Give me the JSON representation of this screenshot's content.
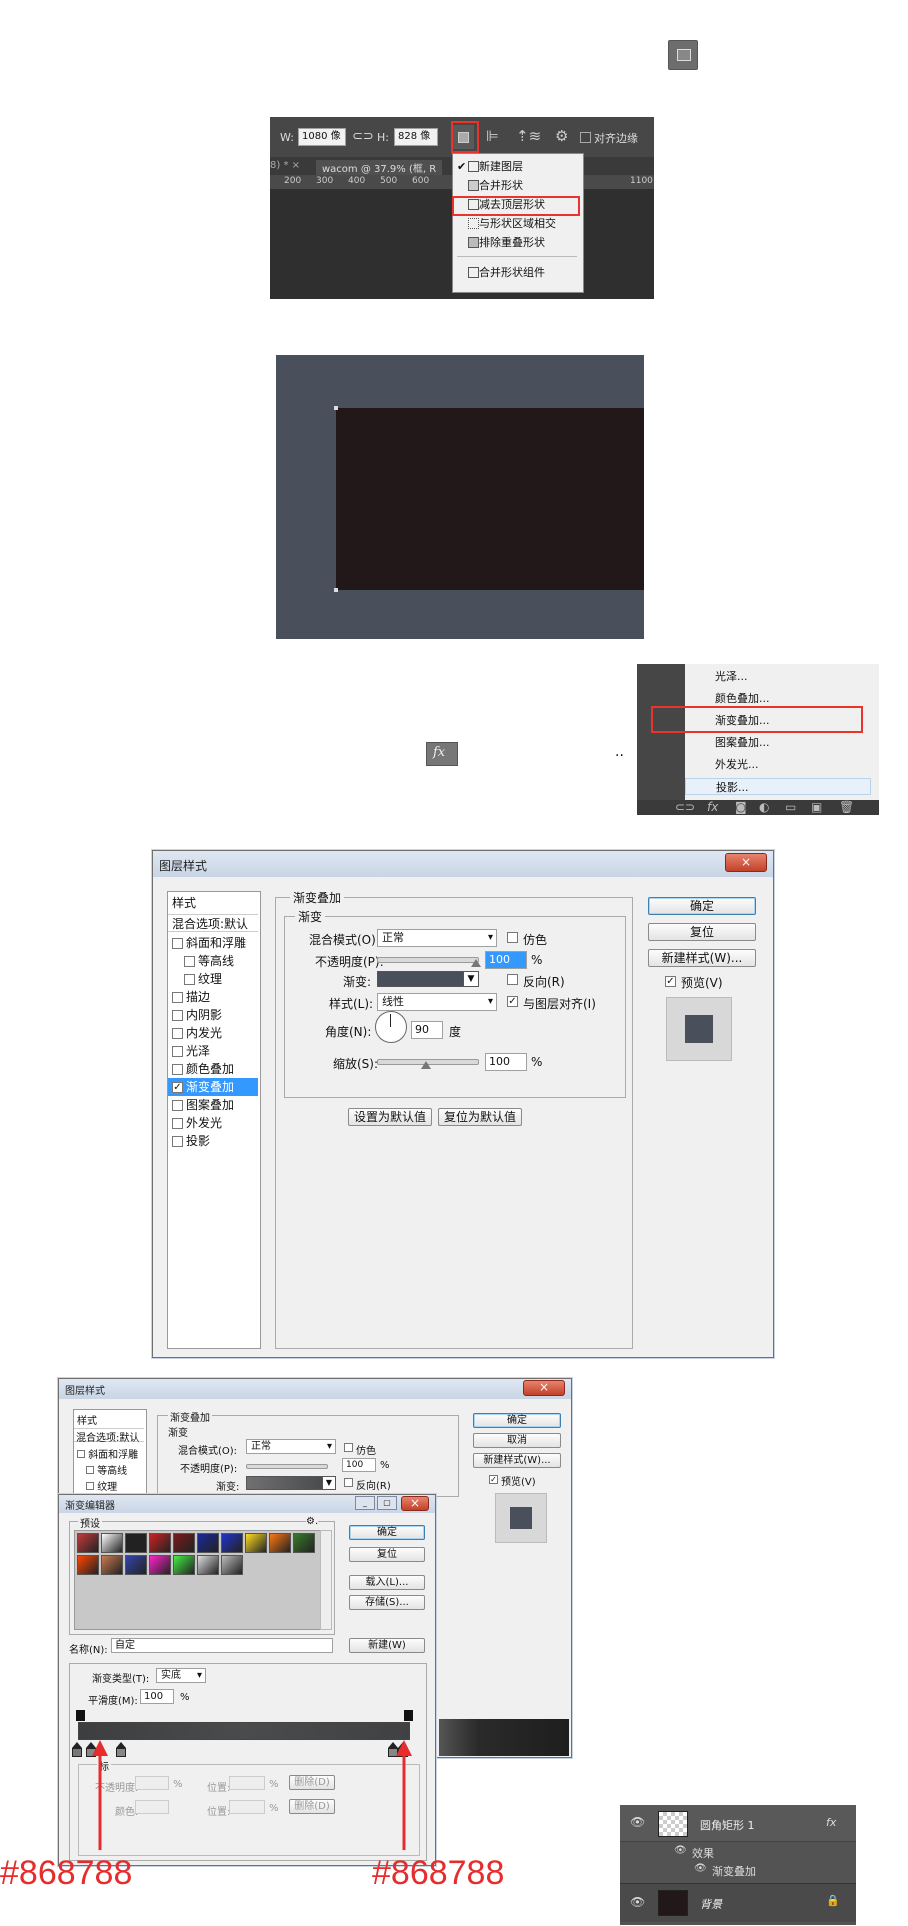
{
  "panel1": {
    "fx_icon_top": "",
    "toolbar": {
      "w_label": "W:",
      "w_value": "1080 像",
      "h_label": "H:",
      "h_value": "828 像",
      "align_edges": "对齐边缘"
    },
    "tabs": {
      "tab1": "8) * ×",
      "tab2": "wacom @ 37.9% (框, R"
    },
    "ruler": [
      "200",
      "300",
      "400",
      "500",
      "600",
      "1100"
    ],
    "menu": {
      "items": [
        "新建图层",
        "合并形状",
        "减去顶层形状",
        "与形状区域相交",
        "排除重叠形状",
        "合并形状组件"
      ],
      "checked_index": 0,
      "highlighted_index": 2
    }
  },
  "panel2": {
    "colors": {
      "outer": "#4a4f5c",
      "inner": "#221819"
    }
  },
  "panel3": {
    "fx_label": "fx",
    "dots": "..",
    "menu_items": [
      "光泽...",
      "颜色叠加...",
      "渐变叠加...",
      "图案叠加...",
      "外发光...",
      "投影..."
    ],
    "highlighted": "渐变叠加...",
    "bottom_icons": [
      "link-icon",
      "fx-icon",
      "mask-icon",
      "adjustment-icon",
      "folder-icon",
      "new-layer-icon",
      "trash-icon"
    ]
  },
  "dialog1": {
    "title": "图层样式",
    "close": "×",
    "left_header": "样式",
    "blend_default": "混合选项:默认",
    "styles": [
      {
        "label": "斜面和浮雕",
        "checked": false,
        "indent": false
      },
      {
        "label": "等高线",
        "checked": false,
        "indent": true
      },
      {
        "label": "纹理",
        "checked": false,
        "indent": true
      },
      {
        "label": "描边",
        "checked": false,
        "indent": false
      },
      {
        "label": "内阴影",
        "checked": false,
        "indent": false
      },
      {
        "label": "内发光",
        "checked": false,
        "indent": false
      },
      {
        "label": "光泽",
        "checked": false,
        "indent": false
      },
      {
        "label": "颜色叠加",
        "checked": false,
        "indent": false
      },
      {
        "label": "渐变叠加",
        "checked": true,
        "indent": false
      },
      {
        "label": "图案叠加",
        "checked": false,
        "indent": false
      },
      {
        "label": "外发光",
        "checked": false,
        "indent": false
      },
      {
        "label": "投影",
        "checked": false,
        "indent": false
      }
    ],
    "group_title": "渐变叠加",
    "sub_group": "渐变",
    "blend_mode_label": "混合模式(O):",
    "blend_mode_value": "正常",
    "dither": "仿色",
    "opacity_label": "不透明度(P):",
    "opacity_value": "100",
    "percent": "%",
    "gradient_label": "渐变:",
    "reverse": "反向(R)",
    "style_label": "样式(L):",
    "style_value": "线性",
    "align_layer": "与图层对齐(I)",
    "angle_label": "角度(N):",
    "angle_value": "90",
    "degree": "度",
    "scale_label": "缩放(S):",
    "scale_value": "100",
    "set_default": "设置为默认值",
    "reset_default": "复位为默认值",
    "ok": "确定",
    "reset": "复位",
    "new_style": "新建样式(W)...",
    "preview": "预览(V)",
    "preview_color": "#4a4f5c"
  },
  "dialog2": {
    "title": "图层样式",
    "left_header": "样式",
    "blend_default": "混合选项:默认",
    "styles": [
      "斜面和浮雕",
      "等高线",
      "纹理"
    ],
    "group_title": "渐变叠加",
    "sub_group": "渐变",
    "blend_mode_label": "混合模式(O):",
    "blend_mode_value": "正常",
    "dither": "仿色",
    "opacity_label": "不透明度(P):",
    "opacity_value": "100",
    "percent": "%",
    "gradient_label": "渐变:",
    "reverse": "反向(R)",
    "ok": "确定",
    "cancel": "取消",
    "new_style": "新建样式(W)...",
    "preview": "预览(V)"
  },
  "gradient_editor": {
    "title": "渐变编辑器",
    "presets_label": "预设",
    "ok": "确定",
    "reset": "复位",
    "load": "载入(L)...",
    "save": "存储(S)...",
    "name_label": "名称(N):",
    "name_value": "自定",
    "new": "新建(W)",
    "type_label": "渐变类型(T):",
    "type_value": "实底",
    "smooth_label": "平滑度(M):",
    "smooth_value": "100",
    "percent": "%",
    "stops_group": "标",
    "opacity_label": "不透明度:",
    "position_label": "位置:",
    "delete": "删除(D)",
    "color_label": "颜色:",
    "stop_color_annotation_left": "#868788",
    "stop_color_annotation_right": "#868788",
    "swatch_colors": [
      [
        "#c43a3a",
        "#ffffff",
        "#222222",
        "#cc2222",
        "#7a1a1a",
        "#1a2a9a",
        "#2233cc",
        "#ffdd22",
        "#ff7711",
        "#3a7a2a"
      ],
      [
        "#ff4400",
        "#c87a50",
        "#3344aa",
        "#ff22cc",
        "#44ee44",
        "#dddddd",
        "#bbbbbb"
      ]
    ]
  },
  "layers_panel": {
    "layer1_name": "圆角矩形 1",
    "effects": "效果",
    "gradient_overlay": "渐变叠加",
    "background": "背景",
    "fx": "fx"
  }
}
